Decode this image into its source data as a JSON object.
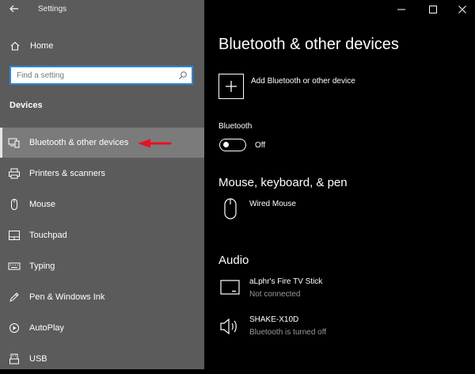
{
  "titlebar": {
    "app_title": "Settings",
    "back_icon": "back-arrow-icon",
    "minimize_icon": "minimize-icon",
    "maximize_icon": "maximize-icon",
    "close_icon": "close-icon"
  },
  "sidebar": {
    "home_label": "Home",
    "home_icon": "home-icon",
    "search_placeholder": "Find a setting",
    "search_icon": "search-icon",
    "section_title": "Devices",
    "items": [
      {
        "label": "Bluetooth & other devices",
        "icon": "bluetooth-devices-icon",
        "active": true
      },
      {
        "label": "Printers & scanners",
        "icon": "printer-icon",
        "active": false
      },
      {
        "label": "Mouse",
        "icon": "mouse-icon",
        "active": false
      },
      {
        "label": "Touchpad",
        "icon": "touchpad-icon",
        "active": false
      },
      {
        "label": "Typing",
        "icon": "keyboard-icon",
        "active": false
      },
      {
        "label": "Pen & Windows Ink",
        "icon": "pen-icon",
        "active": false
      },
      {
        "label": "AutoPlay",
        "icon": "autoplay-icon",
        "active": false
      },
      {
        "label": "USB",
        "icon": "usb-icon",
        "active": false
      }
    ],
    "highlight_arrow_color": "#e81123"
  },
  "main": {
    "title": "Bluetooth & other devices",
    "add_device_label": "Add Bluetooth or other device",
    "bluetooth_section": "Bluetooth",
    "bluetooth_state": "Off",
    "mkp_section": "Mouse, keyboard, & pen",
    "mkp_devices": [
      {
        "name": "Wired Mouse",
        "icon": "mouse-icon"
      }
    ],
    "audio_section": "Audio",
    "audio_devices": [
      {
        "name": "aLphr's Fire TV Stick",
        "status": "Not connected",
        "icon": "display-icon"
      },
      {
        "name": "SHAKE-X10D",
        "status": "Bluetooth is turned off",
        "icon": "speaker-icon"
      }
    ]
  },
  "colors": {
    "sidebar_bg": "#5b5b5b",
    "active_item_bg": "#7b7b7b",
    "main_bg": "#000000",
    "search_border": "#2b88d8",
    "secondary_text": "#9a9a9a"
  }
}
